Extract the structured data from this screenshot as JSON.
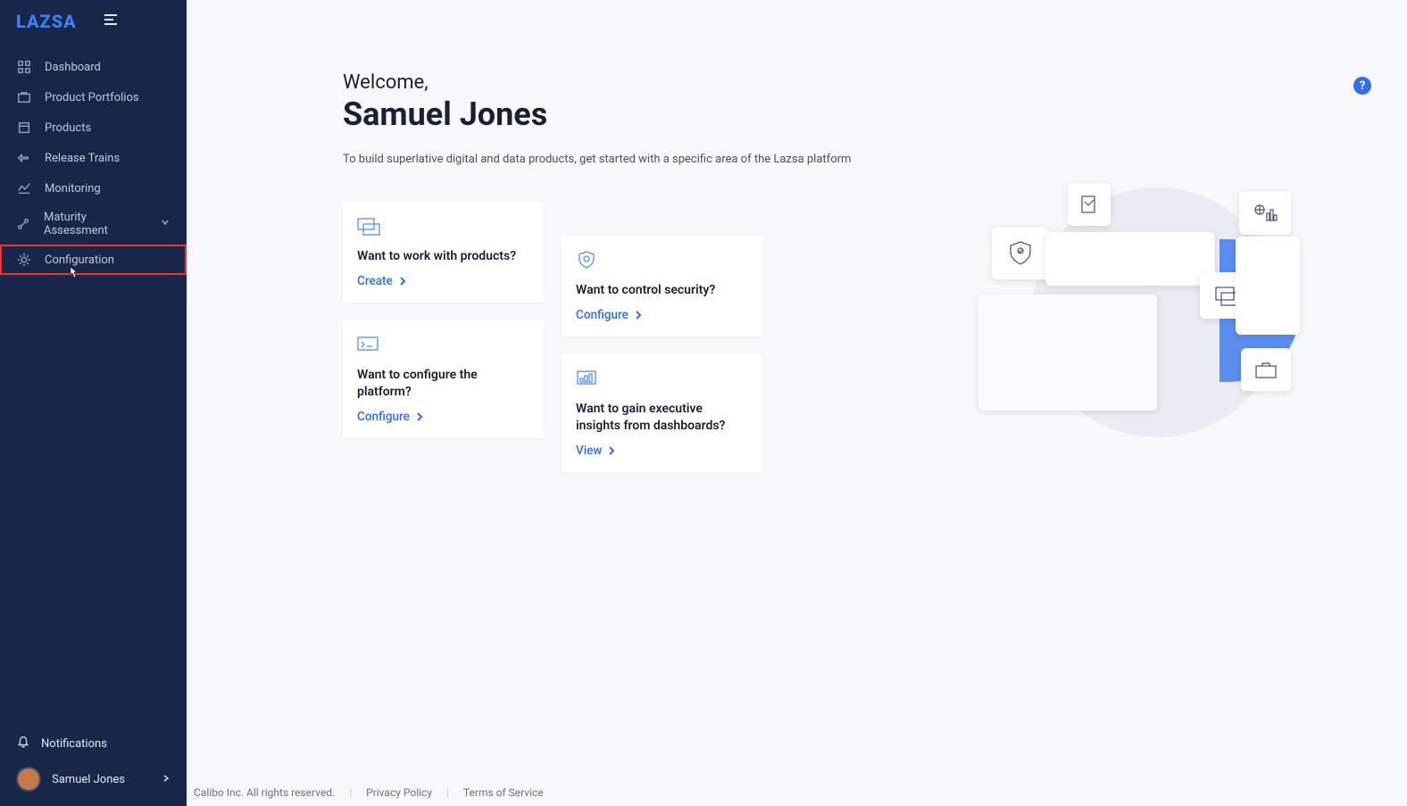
{
  "brand": {
    "name": "LAZSA"
  },
  "sidebar": {
    "items": [
      {
        "label": "Dashboard",
        "icon": "dashboard"
      },
      {
        "label": "Product Portfolios",
        "icon": "portfolio"
      },
      {
        "label": "Products",
        "icon": "products"
      },
      {
        "label": "Release Trains",
        "icon": "release-trains"
      },
      {
        "label": "Monitoring",
        "icon": "monitoring"
      },
      {
        "label": "Maturity Assessment",
        "icon": "maturity",
        "expandable": true
      },
      {
        "label": "Configuration",
        "icon": "settings",
        "highlighted": true
      }
    ],
    "notifications_label": "Notifications",
    "user_name": "Samuel Jones"
  },
  "welcome": {
    "greeting": "Welcome,",
    "name": "Samuel Jones",
    "subtitle": "To build superlative digital and data products, get started with a specific area of the Lazsa platform"
  },
  "cards": {
    "products": {
      "title": "Want to work with products?",
      "action": "Create"
    },
    "platform": {
      "title": "Want to configure the platform?",
      "action": "Configure"
    },
    "security": {
      "title": "Want to control security?",
      "action": "Configure"
    },
    "insights": {
      "title": "Want to gain executive insights from dashboards?",
      "action": "View"
    }
  },
  "help": {
    "glyph": "?"
  },
  "footer": {
    "copyright": "Calibo Inc. All rights reserved.",
    "privacy": "Privacy Policy",
    "terms": "Terms of Service"
  }
}
